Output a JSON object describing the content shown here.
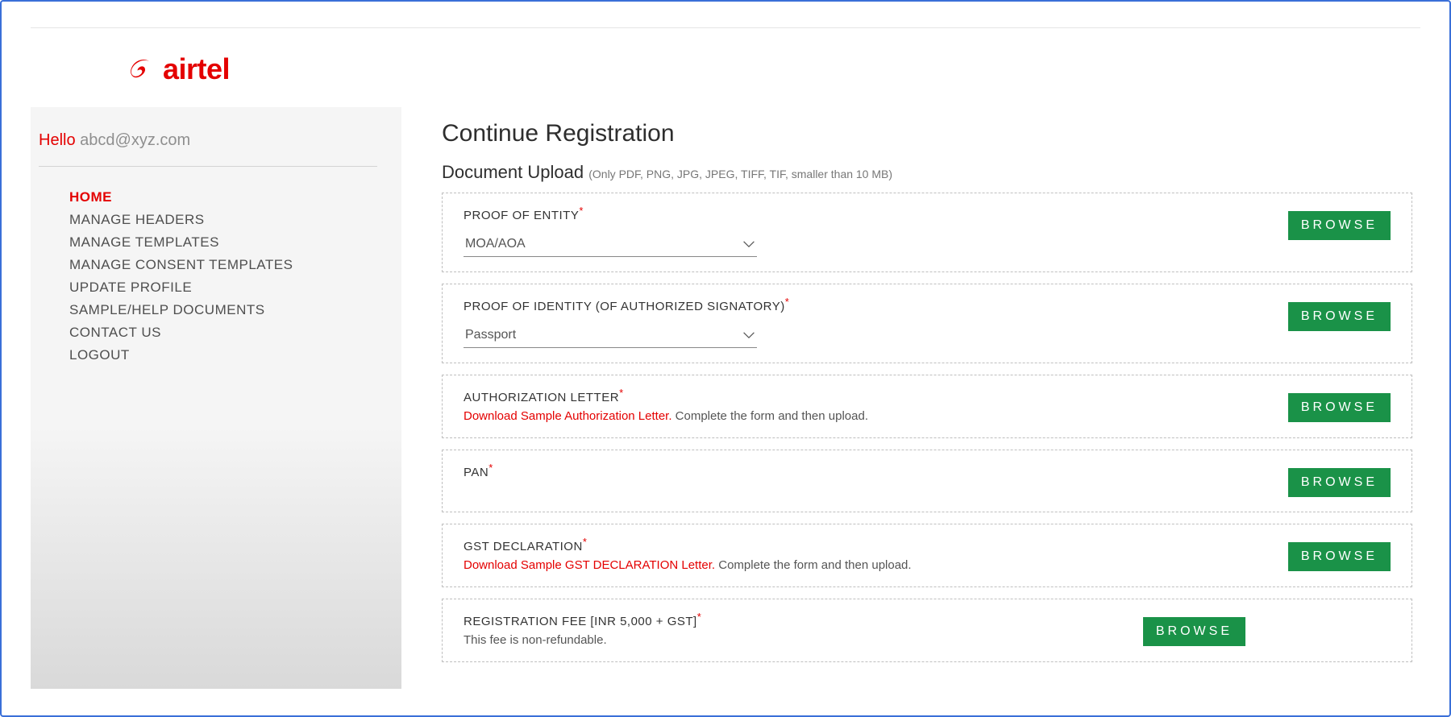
{
  "brand": {
    "name": "airtel"
  },
  "sidebar": {
    "hello_prefix": "Hello",
    "user_email": "abcd@xyz.com",
    "nav": [
      {
        "label": "HOME",
        "active": true
      },
      {
        "label": "MANAGE HEADERS",
        "active": false
      },
      {
        "label": "MANAGE TEMPLATES",
        "active": false
      },
      {
        "label": "MANAGE CONSENT TEMPLATES",
        "active": false
      },
      {
        "label": "UPDATE PROFILE",
        "active": false
      },
      {
        "label": "SAMPLE/HELP DOCUMENTS",
        "active": false
      },
      {
        "label": "CONTACT US",
        "active": false
      },
      {
        "label": "LOGOUT",
        "active": false
      }
    ]
  },
  "main": {
    "title": "Continue Registration",
    "section_label": "Document Upload",
    "section_hint": "(Only PDF, PNG, JPG, JPEG, TIFF, TIF, smaller than 10 MB)",
    "browse_label": "BROWSE",
    "uploads": [
      {
        "key": "entity",
        "label": "PROOF OF ENTITY",
        "required": true,
        "select_value": "MOA/AOA",
        "has_select": true
      },
      {
        "key": "identity",
        "label": "PROOF OF IDENTITY (OF AUTHORIZED SIGNATORY)",
        "required": true,
        "select_value": "Passport",
        "has_select": true
      },
      {
        "key": "authletter",
        "label": "AUTHORIZATION LETTER",
        "required": true,
        "download_text": "Download Sample Authorization Letter.",
        "helper_rest": " Complete the form and then upload."
      },
      {
        "key": "pan",
        "label": "PAN",
        "required": true
      },
      {
        "key": "gstdecl",
        "label": "GST DECLARATION",
        "required": true,
        "download_text": "Download Sample GST DECLARATION Letter.",
        "helper_rest": " Complete the form and then upload."
      },
      {
        "key": "regfee",
        "label": "REGISTRATION FEE [INR 5,000 + GST]",
        "required": true,
        "helper_plain": "This fee is non-refundable.",
        "browse_offset": true
      }
    ]
  }
}
